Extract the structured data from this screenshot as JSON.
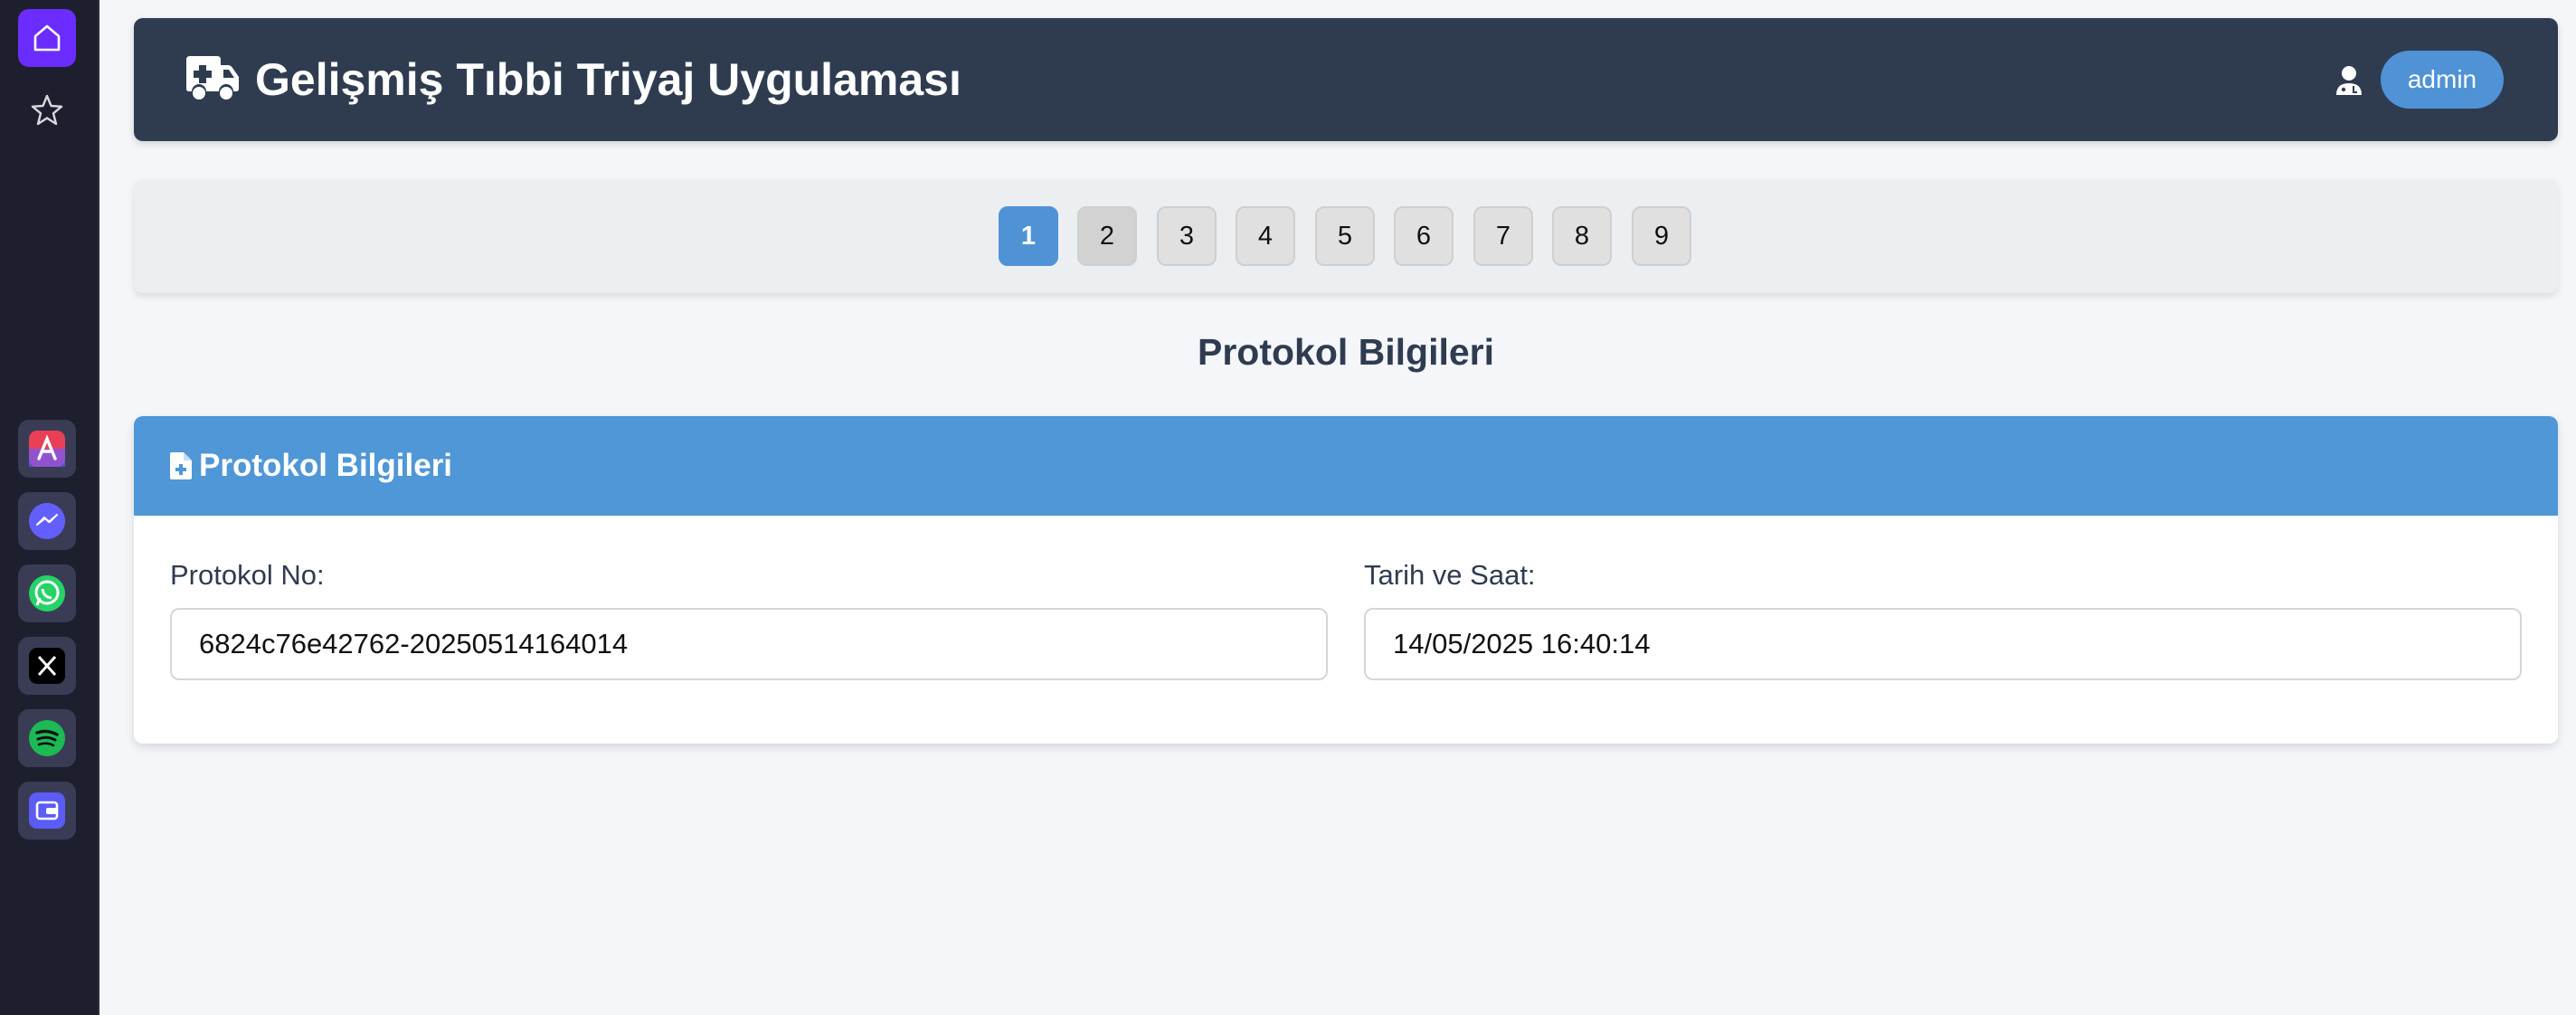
{
  "dock": {
    "items": [
      {
        "name": "home-icon"
      },
      {
        "name": "star-icon"
      },
      {
        "name": "pencil-app-icon",
        "color": "#e94057"
      },
      {
        "name": "messenger-icon",
        "color": "#a033ff"
      },
      {
        "name": "whatsapp-icon",
        "color": "#25d366"
      },
      {
        "name": "x-icon",
        "color": "#000000"
      },
      {
        "name": "spotify-icon",
        "color": "#1db954"
      },
      {
        "name": "wallet-icon",
        "color": "#5b5cf6"
      }
    ]
  },
  "header": {
    "title": "Gelişmiş Tıbbi Triyaj Uygulaması",
    "user_label": "admin",
    "bg_color": "#2f3c50"
  },
  "pagination": {
    "pages": [
      "1",
      "2",
      "3",
      "4",
      "5",
      "6",
      "7",
      "8",
      "9"
    ],
    "active": "1",
    "active_color": "#4f93d6"
  },
  "main": {
    "section_title": "Protokol Bilgileri"
  },
  "card": {
    "title": "Protokol Bilgileri",
    "header_color": "#4f97d7",
    "fields": [
      {
        "label": "Protokol No:",
        "value": "6824c76e42762-20250514164014"
      },
      {
        "label": "Tarih ve Saat:",
        "value": "14/05/2025 16:40:14"
      }
    ]
  }
}
